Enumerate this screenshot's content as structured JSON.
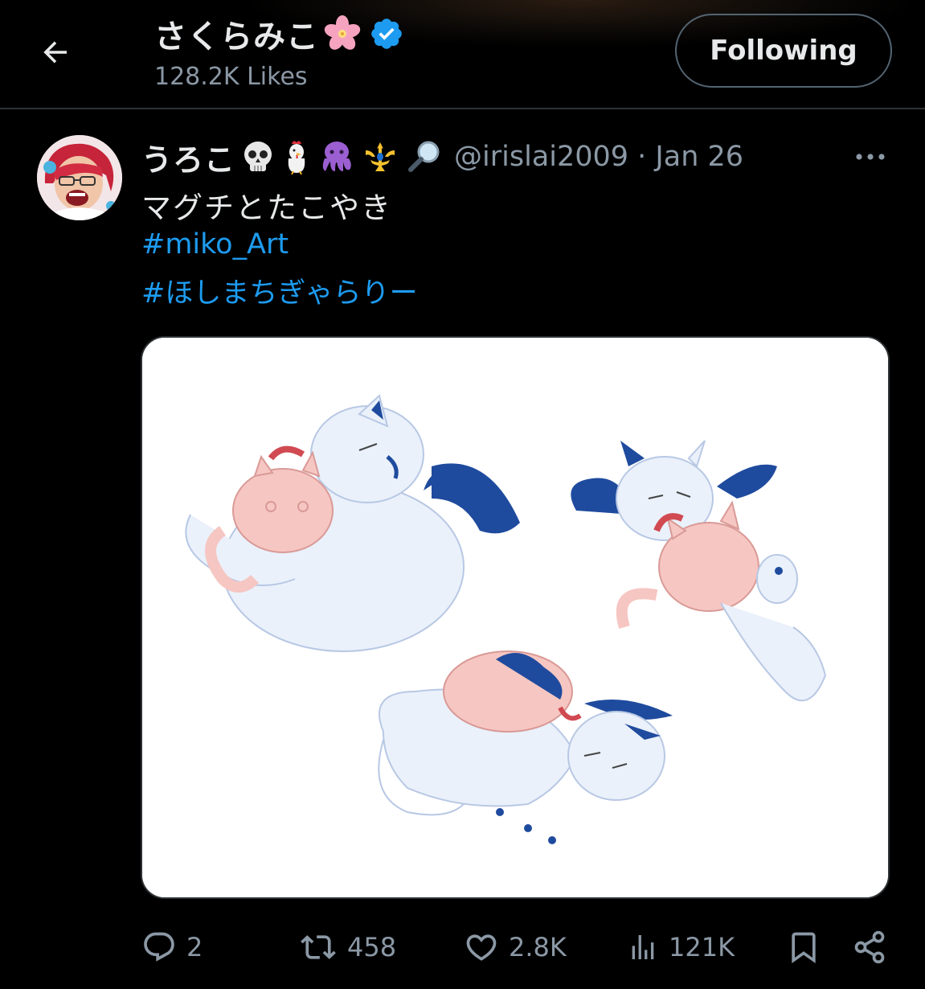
{
  "header": {
    "title": "さくらみこ",
    "likes": "128.2K Likes",
    "follow_label": "Following"
  },
  "tweet": {
    "author_name": "うろこ",
    "handle_date": "@irislai2009 · Jan 26",
    "text": "マグチとたこやき",
    "hashtags": [
      "#miko_Art",
      "#ほしまちぎゃらりー"
    ]
  },
  "actions": {
    "replies": "2",
    "reposts": "458",
    "likes": "2.8K",
    "views": "121K"
  },
  "icons": {
    "back": "arrow-left-icon",
    "verified": "verified-badge-icon",
    "more": "more-horizontal-icon",
    "reply": "reply-icon",
    "repost": "repost-icon",
    "like": "heart-icon",
    "views": "analytics-icon",
    "bookmark": "bookmark-icon",
    "share": "share-icon"
  },
  "colors": {
    "accent": "#1d9bf0",
    "muted": "#8b98a5",
    "background": "#000000"
  }
}
